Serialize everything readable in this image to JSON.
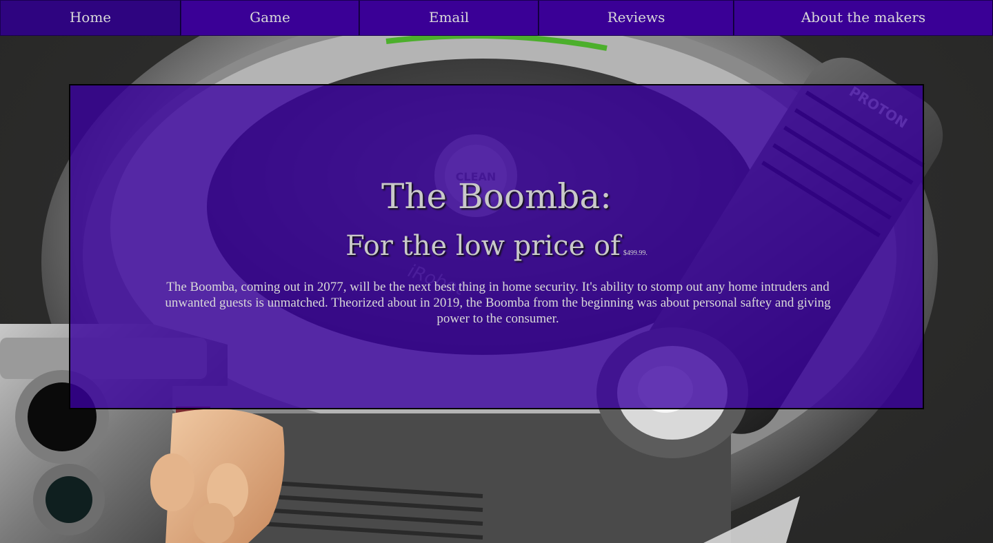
{
  "nav": {
    "items": [
      {
        "label": "Home",
        "active": true
      },
      {
        "label": "Game",
        "active": false
      },
      {
        "label": "Email",
        "active": false
      },
      {
        "label": "Reviews",
        "active": false
      },
      {
        "label": "About the makers",
        "active": false
      }
    ]
  },
  "hero": {
    "title": "The Boomba:",
    "subtitle": "For the low price of",
    "price": "$499.99.",
    "description": "The Boomba, coming out in 2077, will be the next best thing in home security. It's ability to stomp out any home intruders and unwanted guests is unmatched. Theorized about in 2019, the Boomba from the beginning was about personal saftey and giving power to the consumer."
  },
  "background": {
    "depicts": "robot vacuum with handgun and flashlight",
    "vacuum_button_text": "CLEAN",
    "vacuum_brand_text": "iRobot",
    "flashlight_brand_text": "PROTON"
  },
  "colors": {
    "nav_bg": "#3a0096",
    "nav_active_bg": "#2e0480",
    "hero_overlay": "#3a00a0",
    "text": "#c9c9c9",
    "page_bg": "#2b2b2a"
  }
}
